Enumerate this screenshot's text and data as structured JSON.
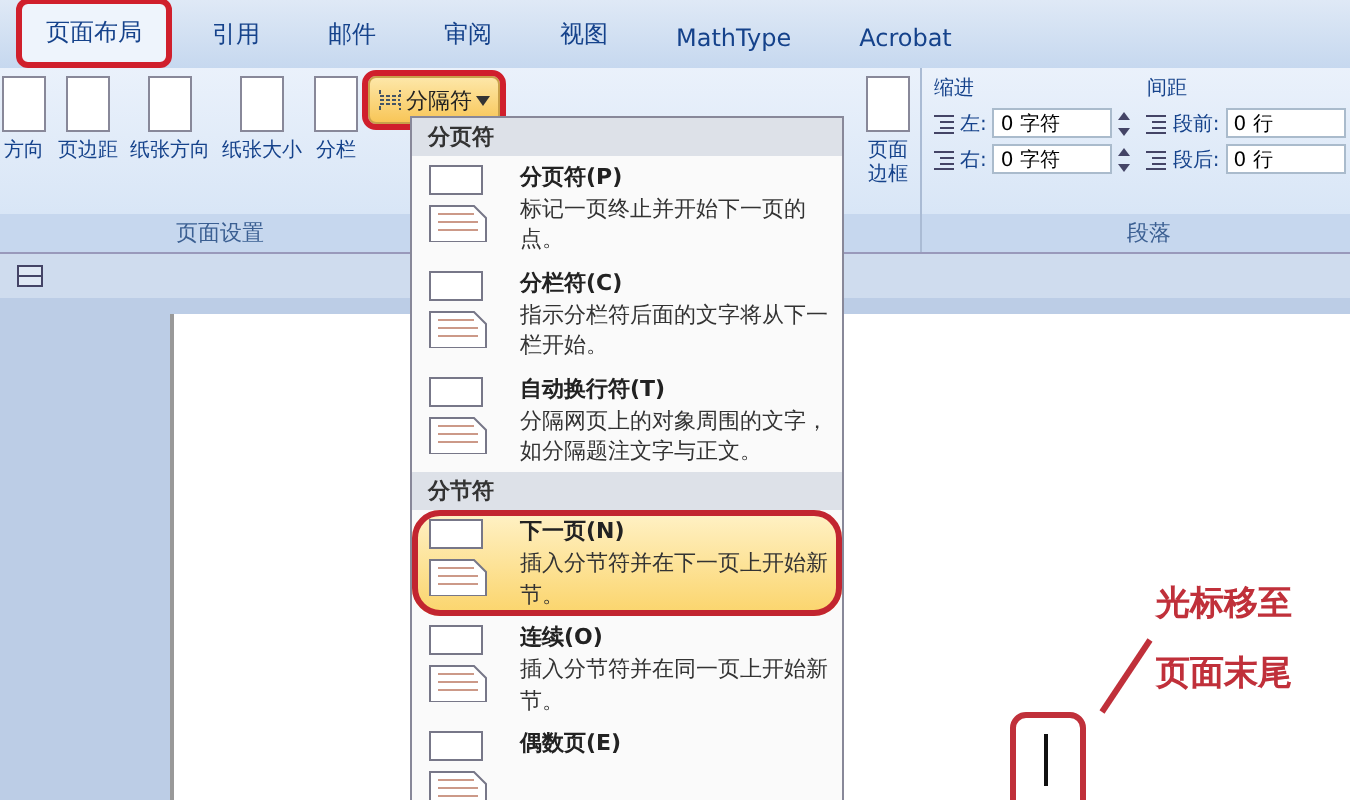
{
  "tabs": [
    {
      "label": "页面布局",
      "selected": true,
      "circled": true
    },
    {
      "label": "引用",
      "selected": false,
      "circled": false
    },
    {
      "label": "邮件",
      "selected": false,
      "circled": false
    },
    {
      "label": "审阅",
      "selected": false,
      "circled": false
    },
    {
      "label": "视图",
      "selected": false,
      "circled": false
    },
    {
      "label": "MathType",
      "selected": false,
      "circled": false
    },
    {
      "label": "Acrobat",
      "selected": false,
      "circled": false
    }
  ],
  "ribbon": {
    "page_setup": {
      "label": "页面设置",
      "buttons": [
        {
          "label": "方向"
        },
        {
          "label": "页边距"
        },
        {
          "label": "纸张方向"
        },
        {
          "label": "纸张大小"
        },
        {
          "label": "分栏"
        }
      ]
    },
    "breaks_button": {
      "label": "分隔符",
      "circled": true
    },
    "page_borders_button": {
      "label": "页面边框"
    },
    "paragraph": {
      "label": "段落",
      "indent": {
        "label": "缩进",
        "fields": [
          {
            "label": "左:",
            "value": "0 字符"
          },
          {
            "label": "右:",
            "value": "0 字符"
          }
        ]
      },
      "spacing": {
        "label": "间距",
        "fields": [
          {
            "label": "段前:",
            "value": "0 行"
          },
          {
            "label": "段后:",
            "value": "0 行"
          }
        ]
      }
    }
  },
  "breaks_menu": {
    "sections": [
      {
        "label": "分页符",
        "items": [
          {
            "title": "分页符(P)",
            "description": "标记一页终止并开始下一页的点。",
            "selected": false,
            "circled": false
          },
          {
            "title": "分栏符(C)",
            "description": "指示分栏符后面的文字将从下一栏开始。",
            "selected": false,
            "circled": false
          },
          {
            "title": "自动换行符(T)",
            "description": "分隔网页上的对象周围的文字，如分隔题注文字与正文。",
            "selected": false,
            "circled": false
          }
        ]
      },
      {
        "label": "分节符",
        "items": [
          {
            "title": "下一页(N)",
            "description": "插入分节符并在下一页上开始新节。",
            "selected": true,
            "circled": true
          },
          {
            "title": "连续(O)",
            "description": "插入分节符并在同一页上开始新节。",
            "selected": false,
            "circled": false
          },
          {
            "title": "偶数页(E)",
            "selected": false,
            "circled": false
          }
        ]
      }
    ]
  },
  "annotation": {
    "lines": [
      "光标移至",
      "页面末尾"
    ]
  }
}
